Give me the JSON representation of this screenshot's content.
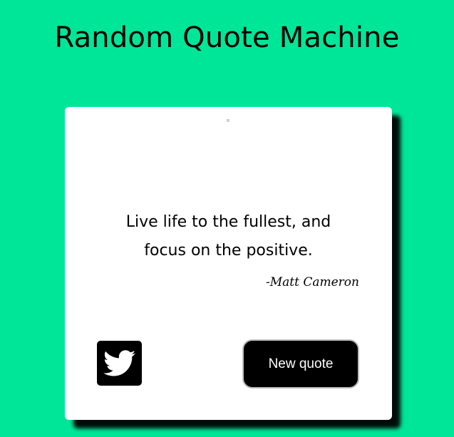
{
  "header": {
    "title": "Random Quote Machine"
  },
  "quote": {
    "line1": "Live life to the fullest, and",
    "line2": "focus on the positive.",
    "author": "-Matt Cameron"
  },
  "actions": {
    "tweet_icon": "twitter-icon",
    "new_quote_label": "New quote"
  },
  "colors": {
    "background": "#00e699",
    "card": "#ffffff",
    "button": "#000000",
    "button_text": "#ffffff"
  }
}
